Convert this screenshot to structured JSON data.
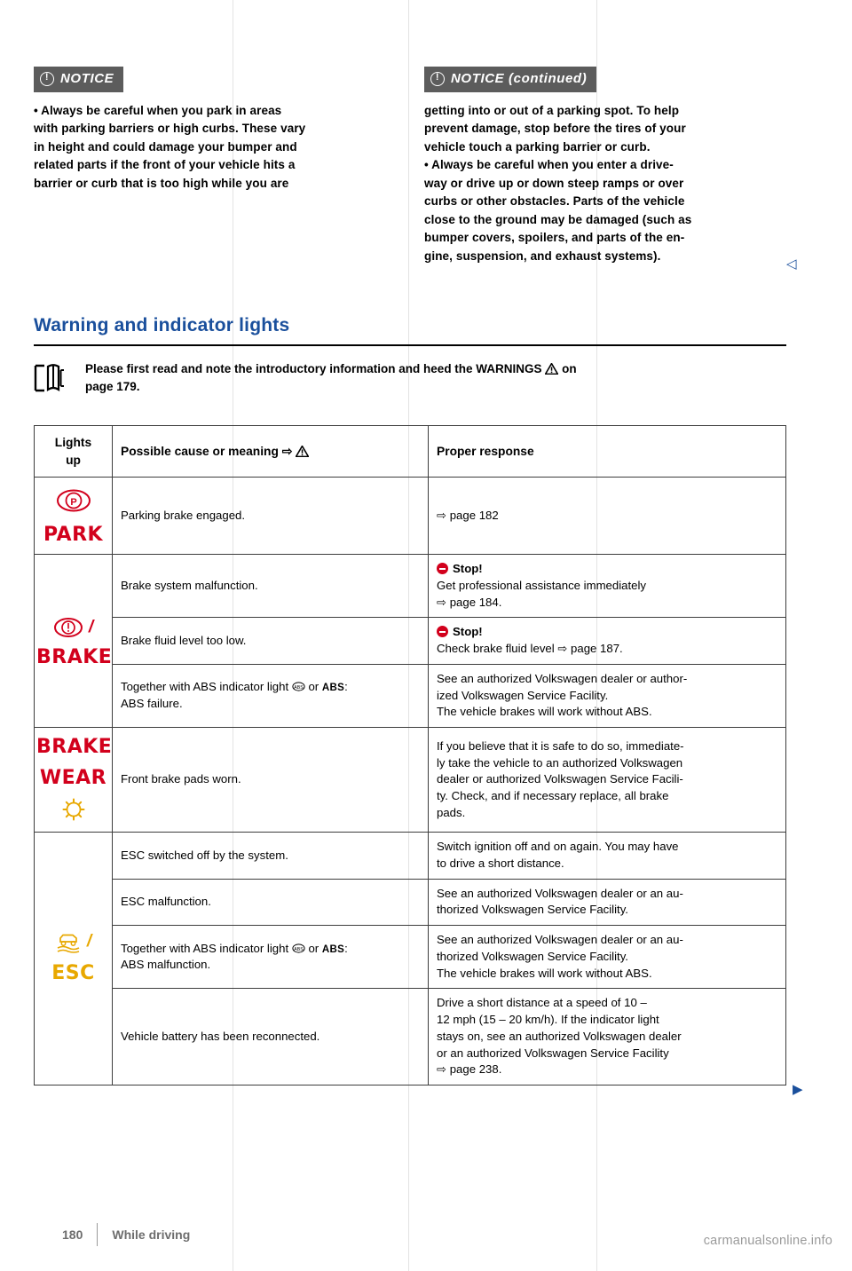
{
  "notice_left": {
    "header": "NOTICE",
    "lines": [
      "•  Always be careful when you park in areas",
      "with parking barriers or high curbs. These vary",
      "in height and could damage your bumper and",
      "related parts if the front of your vehicle hits a",
      "barrier or curb that is too high while you are"
    ]
  },
  "notice_right": {
    "header": "NOTICE (continued)",
    "lines": [
      "getting into or out of a parking spot. To help",
      "prevent damage, stop before the tires of your",
      "vehicle touch a parking barrier or curb.",
      "•  Always be careful when you enter a drive-",
      "way or drive up or down steep ramps or over",
      "curbs or other obstacles. Parts of the vehicle",
      "close to the ground may be damaged (such as",
      "bumper covers, spoilers, and parts of the en-",
      "gine, suspension, and exhaust systems)."
    ]
  },
  "section": {
    "title": "Warning and indicator lights"
  },
  "intro": {
    "text_before": "Please first read and note the introductory information and heed the WARNINGS",
    "text_after": "on",
    "line2": "page 179."
  },
  "table": {
    "headers": {
      "lights": "Lights",
      "lights2": "up",
      "cause": "Possible cause or meaning ⇨",
      "response": "Proper response"
    },
    "rows": [
      {
        "symbol_word": "PARK",
        "symbol_color": "#d2001c",
        "cause": "Parking brake engaged.",
        "response": "⇨ page 182"
      },
      {
        "symbol_word": "BRAKE",
        "symbol_color": "#d2001c",
        "items": [
          {
            "cause": "Brake system malfunction.",
            "response_stop": "Stop!",
            "response_lines": [
              "Get professional assistance immediately",
              "⇨ page 184."
            ]
          },
          {
            "cause": "Brake fluid level too low.",
            "response_stop": "Stop!",
            "response_lines": [
              "Check brake fluid level ⇨ page 187."
            ]
          },
          {
            "cause_pre": "Together with ABS indicator light",
            "cause_mid": "or",
            "cause_abs": "ABS",
            "cause_post": ":",
            "cause_line2": "ABS failure.",
            "response_lines": [
              "See an authorized Volkswagen dealer or author-",
              "ized Volkswagen Service Facility.",
              "The vehicle brakes will work without ABS."
            ]
          }
        ]
      },
      {
        "symbol_word1": "BRAKE",
        "symbol_word2": "WEAR",
        "symbol_color": "#d2001c",
        "cause": "Front brake pads worn.",
        "response_lines": [
          "If you believe that it is safe to do so, immediate-",
          "ly take the vehicle to an authorized Volkswagen",
          "dealer or authorized Volkswagen Service Facili-",
          "ty. Check, and if necessary replace, all brake",
          "pads."
        ]
      },
      {
        "symbol_word": "ESC",
        "symbol_color": "#e8a800",
        "items": [
          {
            "cause": "ESC switched off by the system.",
            "response_lines": [
              "Switch ignition off and on again. You may have",
              "to drive a short distance."
            ]
          },
          {
            "cause": "ESC malfunction.",
            "response_lines": [
              "See an authorized Volkswagen dealer or an au-",
              "thorized Volkswagen Service Facility."
            ]
          },
          {
            "cause_pre": "Together with ABS indicator light",
            "cause_mid": "or",
            "cause_abs": "ABS",
            "cause_post": ":",
            "cause_line2": "ABS malfunction.",
            "response_lines": [
              "See an authorized Volkswagen dealer or an au-",
              "thorized Volkswagen Service Facility.",
              "The vehicle brakes will work without ABS."
            ]
          },
          {
            "cause": "Vehicle battery has been reconnected.",
            "response_lines": [
              "Drive a short distance at a speed of 10 –",
              "12 mph (15 – 20 km/h). If the indicator light",
              "stays on, see an authorized Volkswagen dealer",
              "or an authorized Volkswagen Service Facility",
              "⇨ page 238."
            ]
          }
        ]
      }
    ]
  },
  "footer": {
    "page_number": "180",
    "chapter": "While driving"
  },
  "watermark": "carmanualsonline.info",
  "arrows": {
    "left": "◁",
    "right": "▶"
  }
}
